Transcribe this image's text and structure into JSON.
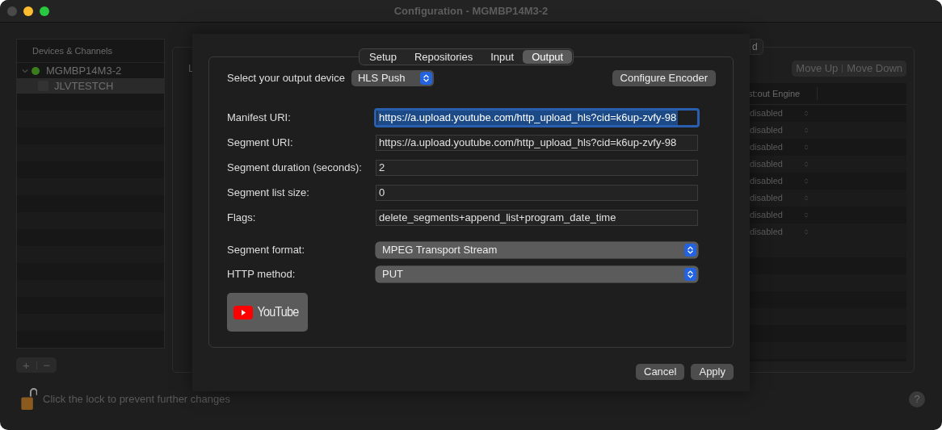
{
  "window": {
    "title": "Configuration - MGMBP14M3-2"
  },
  "sidebar": {
    "header": "Devices & Channels",
    "tree": [
      {
        "label": "MGMBP14M3-2",
        "expanded": true,
        "color": "#3a7d1c",
        "children": [
          {
            "label": "JLVTESTCH",
            "checked": false,
            "selected": true
          }
        ]
      }
    ],
    "add_button": "+",
    "remove_button": "−"
  },
  "main_panel": {
    "label_fragment": "L",
    "tab_fragment": "d",
    "buttons": [
      "Move Up",
      "Move Down"
    ],
    "table": {
      "columns": [
        "st:out Engine"
      ],
      "rows": [
        "disabled",
        "disabled",
        "disabled",
        "disabled",
        "disabled",
        "disabled",
        "disabled",
        "disabled"
      ]
    }
  },
  "lock": {
    "locked": false,
    "text": "Click the lock to prevent further changes"
  },
  "help_button": "?",
  "sheet": {
    "tabs": [
      {
        "label": "Setup",
        "selected": false
      },
      {
        "label": "Repositories",
        "selected": false
      },
      {
        "label": "Input",
        "selected": false
      },
      {
        "label": "Output",
        "selected": true
      }
    ],
    "device_label": "Select your output device",
    "device_value": "HLS Push",
    "configure_button": "Configure Encoder",
    "fields": [
      {
        "kind": "text",
        "label": "Manifest URI:",
        "value": "https://a.upload.youtube.com/http_upload_hls?cid=k6up-zvfy-98",
        "focused": true
      },
      {
        "kind": "text",
        "label": "Segment URI:",
        "value": "https://a.upload.youtube.com/http_upload_hls?cid=k6up-zvfy-98",
        "focused": false
      },
      {
        "kind": "text",
        "label": "Segment duration (seconds):",
        "value": "2",
        "focused": false
      },
      {
        "kind": "text",
        "label": "Segment list size:",
        "value": "0",
        "focused": false
      },
      {
        "kind": "text",
        "label": "Flags:",
        "value": "delete_segments+append_list+program_date_time",
        "focused": false
      },
      {
        "kind": "select",
        "label": "Segment format:",
        "value": "MPEG Transport Stream"
      },
      {
        "kind": "select",
        "label": "HTTP method:",
        "value": "PUT"
      }
    ],
    "logo_button": "YouTube",
    "buttons": [
      "Cancel",
      "Apply"
    ]
  }
}
